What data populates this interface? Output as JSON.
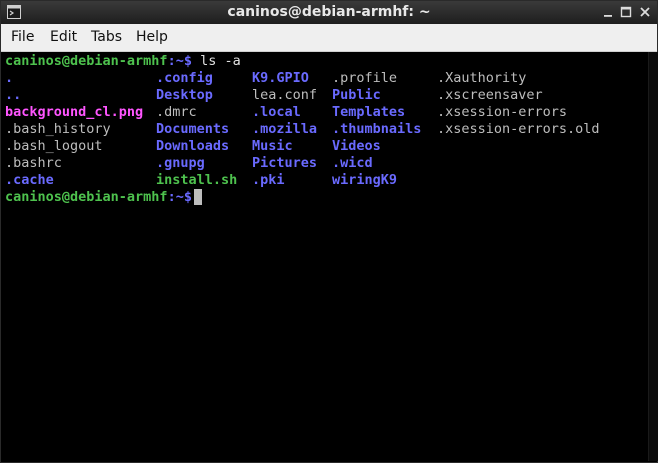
{
  "window": {
    "title": "caninos@debian-armhf: ~"
  },
  "menubar": {
    "items": [
      "File",
      "Edit",
      "Tabs",
      "Help"
    ]
  },
  "terminal": {
    "command_prompt": {
      "user_host": "caninos@debian-armhf",
      "path_symbol": ":~$",
      "command": " ls -a"
    },
    "listing_rows": [
      [
        ".",
        ".config",
        "K9.GPIO",
        ".profile",
        ".Xauthority"
      ],
      [
        "..",
        "Desktop",
        "lea.conf",
        "Public",
        ".xscreensaver"
      ],
      [
        "background_cl.png",
        ".dmrc",
        ".local",
        "Templates",
        ".xsession-errors"
      ],
      [
        ".bash_history",
        "Documents",
        ".mozilla",
        ".thumbnails",
        ".xsession-errors.old"
      ],
      [
        ".bash_logout",
        "Downloads",
        "Music",
        "Videos",
        ""
      ],
      [
        ".bashrc",
        ".gnupg",
        "Pictures",
        ".wicd",
        ""
      ],
      [
        ".cache",
        "install.sh",
        ".pki",
        "wiringK9",
        ""
      ]
    ],
    "final_prompt": {
      "user_host": "caninos@debian-armhf",
      "path_symbol": ":~$"
    }
  },
  "colors": {
    "prompt": "#4ec24e",
    "directory": "#6a6aff",
    "file": "#bdbdbd",
    "image": "#ff55ff",
    "executable": "#4ec24e"
  }
}
